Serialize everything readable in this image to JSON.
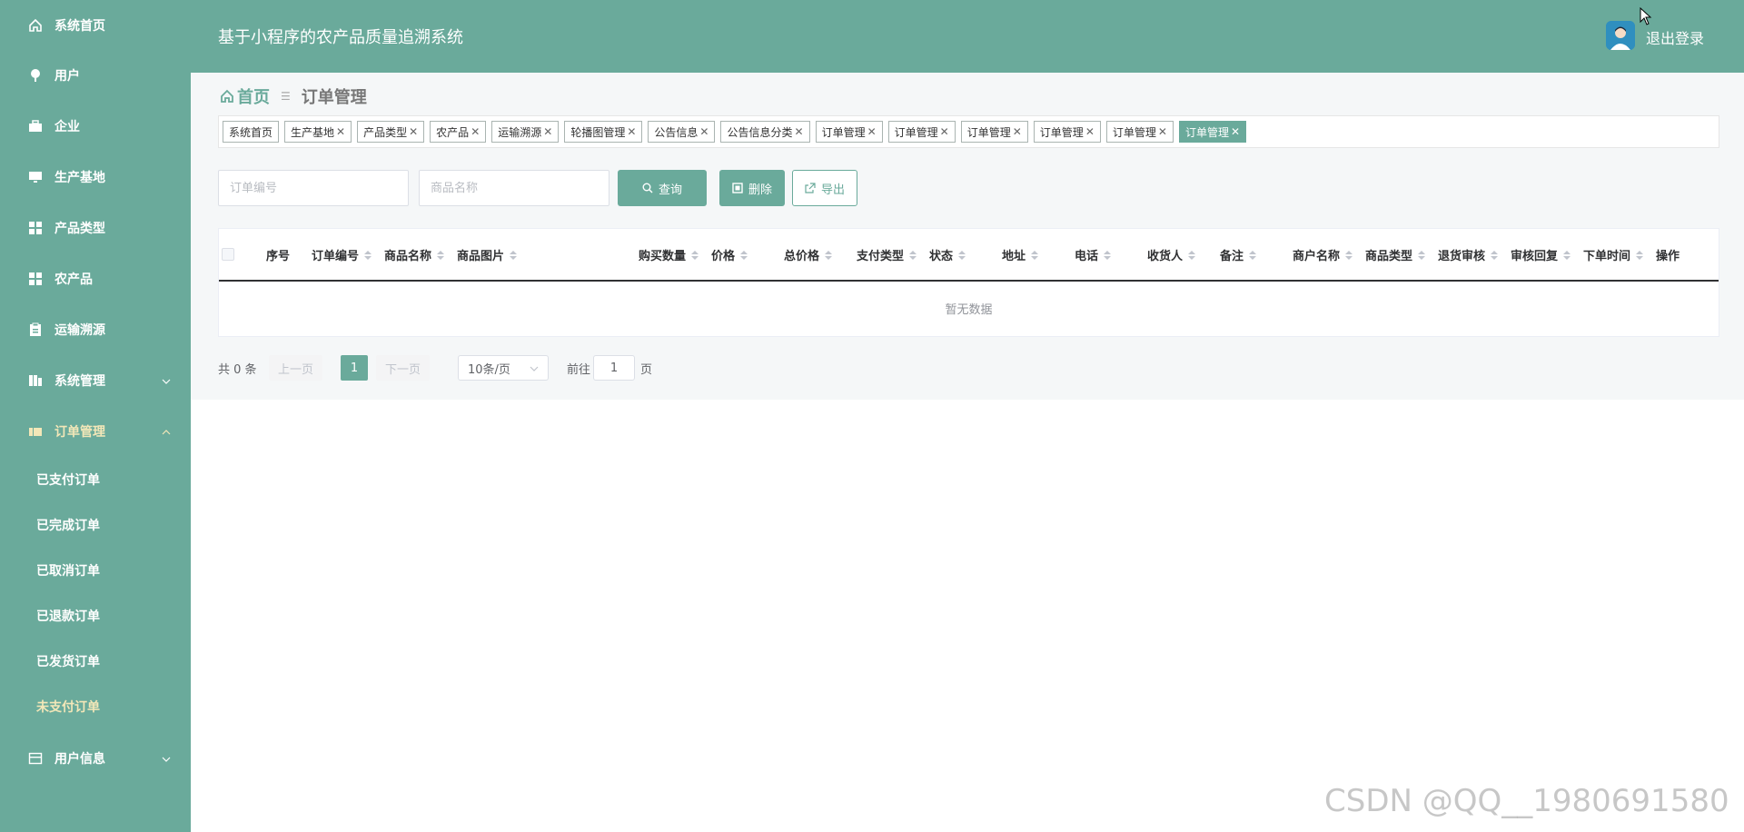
{
  "sidebar": {
    "items": [
      {
        "label": "系统首页",
        "icon": "home-icon"
      },
      {
        "label": "用户",
        "icon": "pin-icon"
      },
      {
        "label": "企业",
        "icon": "briefcase-icon"
      },
      {
        "label": "生产基地",
        "icon": "monitor-icon"
      },
      {
        "label": "产品类型",
        "icon": "grid-icon"
      },
      {
        "label": "农产品",
        "icon": "grid-icon"
      },
      {
        "label": "运输溯源",
        "icon": "clipboard-icon"
      },
      {
        "label": "系统管理",
        "icon": "columns-icon",
        "expanded": false
      },
      {
        "label": "订单管理",
        "icon": "ticket-icon",
        "expanded": true
      },
      {
        "label": "用户信息",
        "icon": "card-icon",
        "expanded": false
      }
    ],
    "order_subitems": [
      "已支付订单",
      "已完成订单",
      "已取消订单",
      "已退款订单",
      "已发货订单",
      "未支付订单"
    ]
  },
  "header": {
    "title": "基于小程序的农产品质量追溯系统",
    "logout": "退出登录"
  },
  "breadcrumb": {
    "home": "首页",
    "current": "订单管理"
  },
  "tabs": [
    {
      "label": "系统首页",
      "closable": false
    },
    {
      "label": "生产基地",
      "closable": true
    },
    {
      "label": "产品类型",
      "closable": true
    },
    {
      "label": "农产品",
      "closable": true
    },
    {
      "label": "运输溯源",
      "closable": true
    },
    {
      "label": "轮播图管理",
      "closable": true
    },
    {
      "label": "公告信息",
      "closable": true
    },
    {
      "label": "公告信息分类",
      "closable": true
    },
    {
      "label": "订单管理",
      "closable": true
    },
    {
      "label": "订单管理",
      "closable": true
    },
    {
      "label": "订单管理",
      "closable": true
    },
    {
      "label": "订单管理",
      "closable": true
    },
    {
      "label": "订单管理",
      "closable": true
    },
    {
      "label": "订单管理",
      "closable": true,
      "active": true
    }
  ],
  "search": {
    "order_no_placeholder": "订单编号",
    "product_name_placeholder": "商品名称",
    "query_label": "查询",
    "delete_label": "删除",
    "export_label": "导出"
  },
  "table": {
    "columns": [
      "序号",
      "订单编号",
      "商品名称",
      "商品图片",
      "购买数量",
      "价格",
      "总价格",
      "支付类型",
      "状态",
      "地址",
      "电话",
      "收货人",
      "备注",
      "商户名称",
      "商品类型",
      "退货审核",
      "审核回复",
      "下单时间",
      "操作"
    ],
    "empty_text": "暂无数据"
  },
  "pagination": {
    "total": "共 0 条",
    "prev": "上一页",
    "current_page": "1",
    "next": "下一页",
    "page_size": "10条/页",
    "goto_label": "前往",
    "goto_value": "1",
    "page_suffix": "页"
  },
  "colors": {
    "primary": "#6aaa9b",
    "active_menu_text": "#f3e7b8"
  },
  "watermark": "CSDN @QQ__1980691580"
}
